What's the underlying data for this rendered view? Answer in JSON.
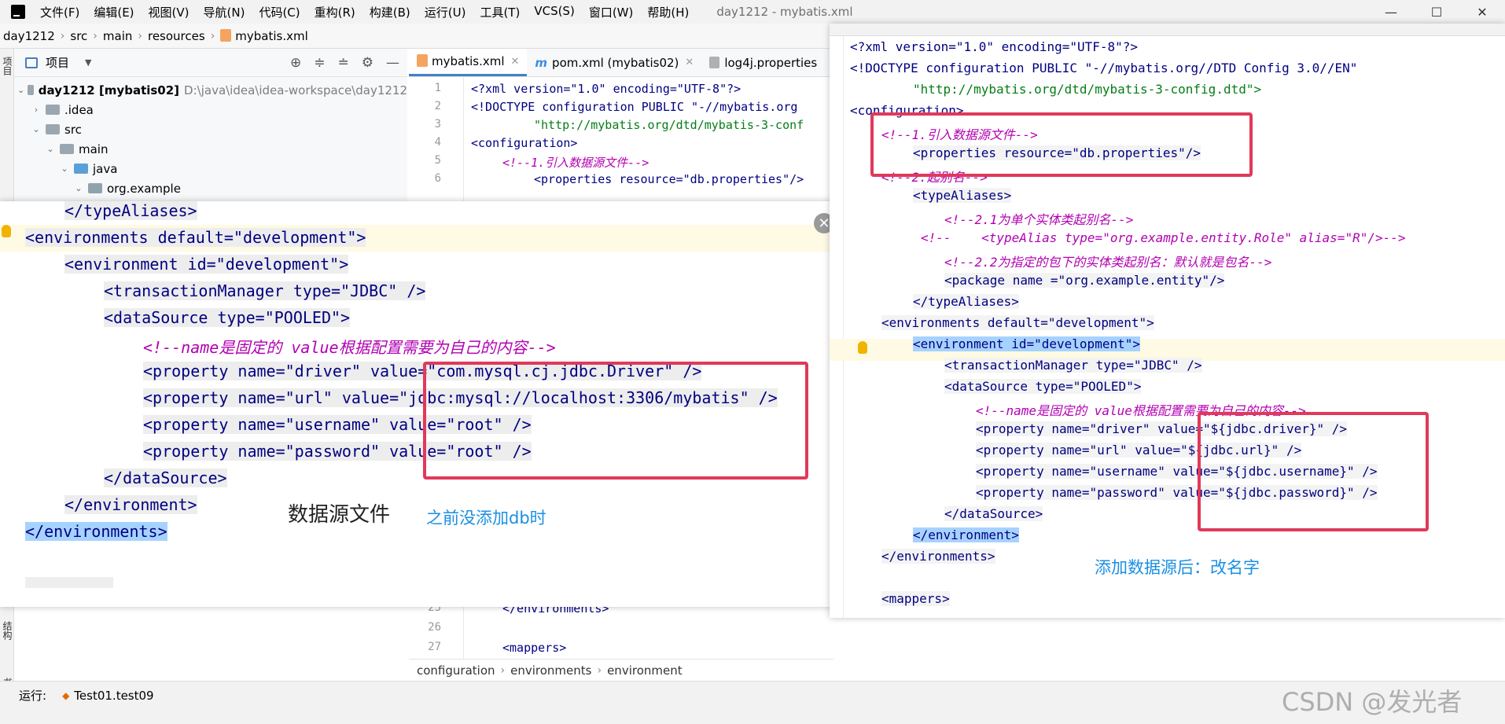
{
  "menu": {
    "items": [
      "文件(F)",
      "编辑(E)",
      "视图(V)",
      "导航(N)",
      "代码(C)",
      "重构(R)",
      "构建(B)",
      "运行(U)",
      "工具(T)",
      "VCS(S)",
      "窗口(W)",
      "帮助(H)"
    ],
    "window_title": "day1212 - mybatis.xml"
  },
  "navbar": {
    "crumbs": [
      "day1212",
      "src",
      "main",
      "resources",
      "mybatis.xml"
    ]
  },
  "side_stripe": {
    "top_label": "项目",
    "mid_label": "结构",
    "bottom_label": "书签"
  },
  "project": {
    "header_label": "项目",
    "tree": [
      {
        "label": "day1212 [mybatis02]",
        "path": "D:\\java\\idea\\idea-workspace\\day1212"
      },
      {
        "label": ".idea"
      },
      {
        "label": "src"
      },
      {
        "label": "main"
      },
      {
        "label": "java"
      },
      {
        "label": "org.example"
      }
    ]
  },
  "editor": {
    "tabs": [
      {
        "label": "mybatis.xml"
      },
      {
        "label": "pom.xml (mybatis02)"
      },
      {
        "label": "log4j.properties"
      }
    ],
    "line_numbers": [
      "1",
      "2",
      "3",
      "4",
      "5",
      "6",
      "25",
      "26",
      "27"
    ],
    "code": {
      "l1_decl": "<?xml version=\"1.0\" encoding=\"UTF-8\"?>",
      "l2_doctype": "<!DOCTYPE configuration PUBLIC \"-//mybatis.org",
      "l3_dtd": "\"http://mybatis.org/dtd/mybatis-3-conf",
      "l4_config": "<configuration>",
      "l5_comment": "<!--1.引入数据源文件-->",
      "l6_props": "<properties resource=\"db.properties\"/>",
      "l25": "</environments>",
      "l27": "<mappers>"
    },
    "breadcrumb": [
      "configuration",
      "environments",
      "environment"
    ]
  },
  "run_bar": {
    "label": "运行:",
    "config": "Test01.test09"
  },
  "overlay_left": {
    "lines": [
      "</typeAliases>",
      "<environments default=\"development\">",
      "<environment id=\"development\">",
      "<transactionManager type=\"JDBC\" />",
      "<dataSource type=\"POOLED\">",
      "<!--name是固定的 value根据配置需要为自己的内容-->",
      "<property name=\"driver\" value=\"com.mysql.cj.jdbc.Driver\" />",
      "<property name=\"url\" value=\"jdbc:mysql://localhost:3306/mybatis\" />",
      "<property name=\"username\" value=\"root\" />",
      "<property name=\"password\" value=\"root\" />",
      "</dataSource>",
      "</environment>",
      "</environments>"
    ],
    "note_title": "数据源文件",
    "note_sub": "之前没添加db时"
  },
  "overlay_right": {
    "lines": [
      "<?xml version=\"1.0\" encoding=\"UTF-8\"?>",
      "<!DOCTYPE configuration PUBLIC \"-//mybatis.org//DTD Config 3.0//EN\"",
      "\"http://mybatis.org/dtd/mybatis-3-config.dtd\">",
      "<configuration>",
      "<!--1.引入数据源文件-->",
      "<properties resource=\"db.properties\"/>",
      "<!--2.起别名-->",
      "<typeAliases>",
      "<!--2.1为单个实体类起别名-->",
      "<!--    <typeAlias type=\"org.example.entity.Role\" alias=\"R\"/>-->",
      "<!--2.2为指定的包下的实体类起别名：默认就是包名-->",
      "<package name =\"org.example.entity\"/>",
      "</typeAliases>",
      "<environments default=\"development\">",
      "<environment id=\"development\">",
      "<transactionManager type=\"JDBC\" />",
      "<dataSource type=\"POOLED\">",
      "<!--name是固定的 value根据配置需要为自己的内容-->",
      "<property name=\"driver\" value=\"${jdbc.driver}\" />",
      "<property name=\"url\" value=\"${jdbc.url}\" />",
      "<property name=\"username\" value=\"${jdbc.username}\" />",
      "<property name=\"password\" value=\"${jdbc.password}\" />",
      "</dataSource>",
      "</environment>",
      "</environments>",
      "",
      "<mappers>"
    ],
    "note": "添加数据源后：改名字"
  },
  "watermark": "CSDN @发光者",
  "colors": {
    "tag": "#000080",
    "attr": "#174ad4",
    "value": "#067d17",
    "comment": "#8c8c8c",
    "accent_red": "#e0395a",
    "note_blue": "#1a8fe3"
  }
}
